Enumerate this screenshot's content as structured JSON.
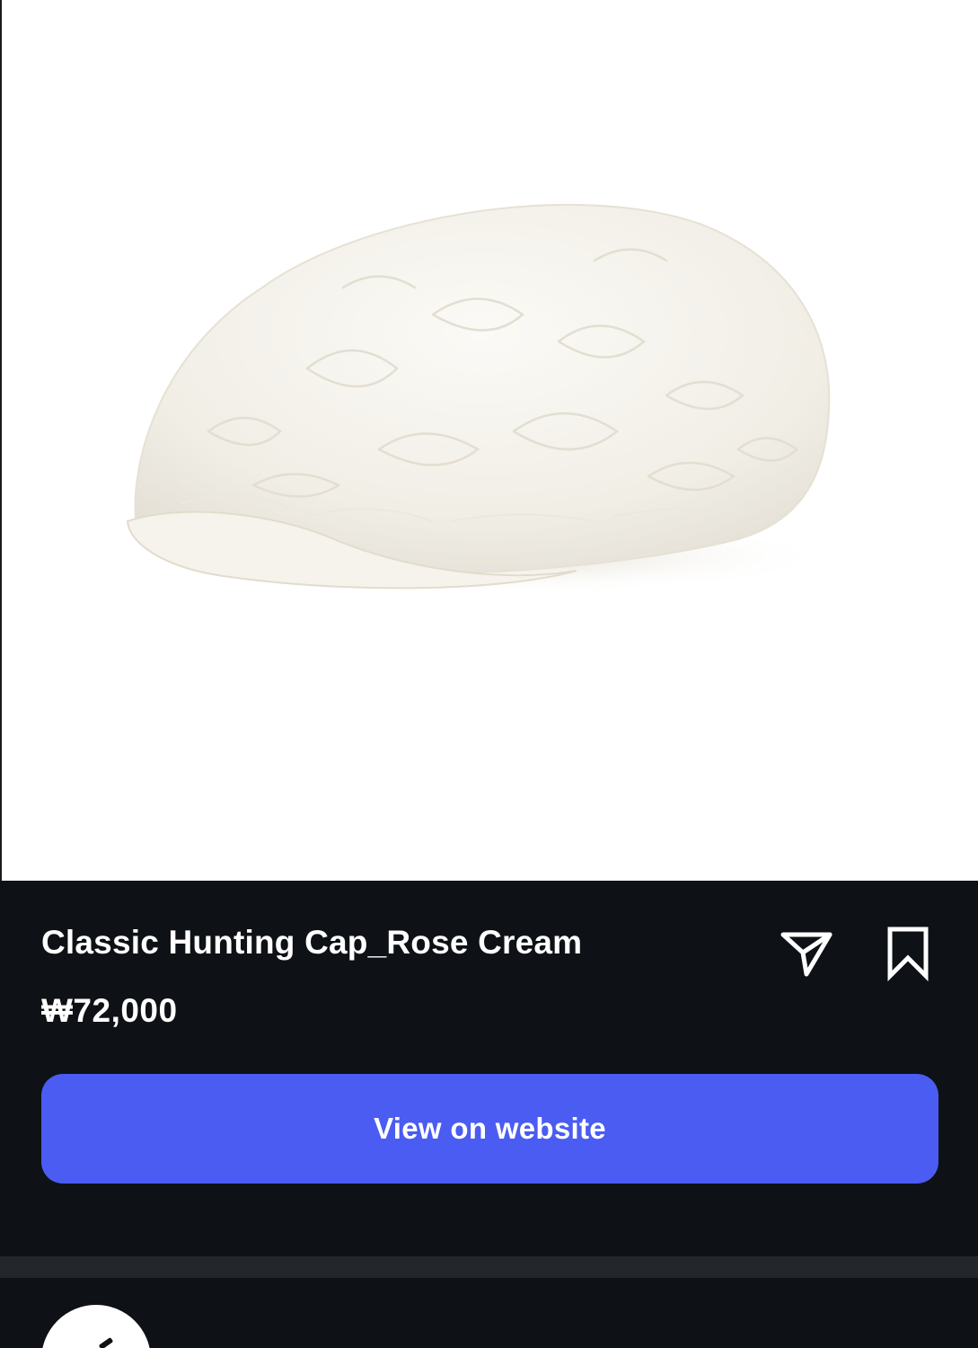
{
  "product": {
    "image_alt": "Classic Hunting Cap_Rose Cream",
    "title": "Classic Hunting Cap_Rose Cream",
    "price": "₩72,000"
  },
  "actions": {
    "share_icon": "paper-plane-icon",
    "save_icon": "bookmark-icon",
    "view_website_label": "View on website"
  },
  "colors": {
    "panel_background": "#0e1116",
    "button_accent": "#4a5cf2",
    "divider": "#23262b",
    "text": "#ffffff"
  }
}
